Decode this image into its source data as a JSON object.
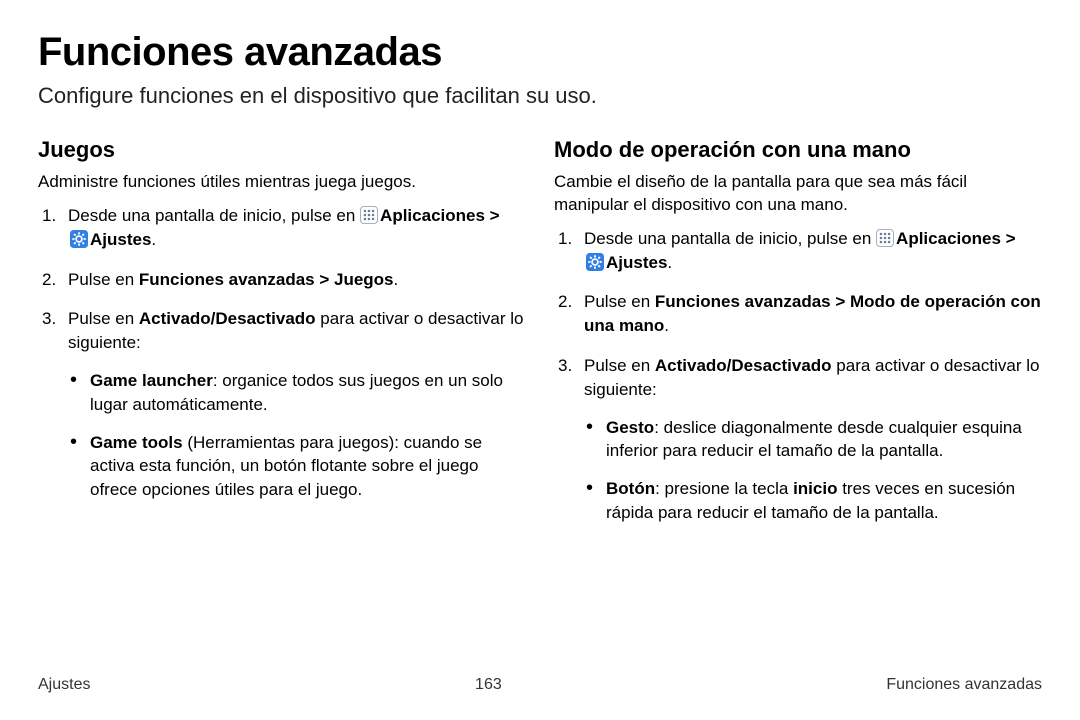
{
  "page": {
    "title": "Funciones avanzadas",
    "subtitle": "Configure funciones en el dispositivo que facilitan su uso."
  },
  "icons": {
    "apps_label": "Aplicaciones",
    "settings_label": "Ajustes"
  },
  "left": {
    "heading": "Juegos",
    "desc": "Administre funciones útiles mientras juega juegos.",
    "step1_a": "Desde una pantalla de inicio, pulse en ",
    "step1_apps": "Aplicaciones",
    "step1_sep": " > ",
    "step1_settings": "Ajustes",
    "step1_end": ".",
    "step2_a": "Pulse en ",
    "step2_b": "Funciones avanzadas > Juegos",
    "step2_c": ".",
    "step3_a": "Pulse en ",
    "step3_b": "Activado/Desactivado",
    "step3_c": " para activar o desactivar lo siguiente:",
    "bullet1_b": "Game launcher",
    "bullet1_t": ": organice todos sus juegos en un solo lugar automáticamente.",
    "bullet2_b": "Game tools",
    "bullet2_t": " (Herramientas para juegos): cuando se activa esta función, un botón flotante sobre el juego ofrece opciones útiles para el juego."
  },
  "right": {
    "heading": "Modo de operación con una mano",
    "desc": "Cambie el diseño de la pantalla para que sea más fácil manipular el dispositivo con una mano.",
    "step1_a": "Desde una pantalla de inicio, pulse en ",
    "step1_apps": "Aplicaciones",
    "step1_sep": " > ",
    "step1_settings": "Ajustes",
    "step1_end": ".",
    "step2_a": "Pulse en ",
    "step2_b": "Funciones avanzadas > Modo de operación con una mano",
    "step2_c": ".",
    "step3_a": "Pulse en ",
    "step3_b": "Activado/Desactivado",
    "step3_c": " para activar o desactivar lo siguiente:",
    "bullet1_b": "Gesto",
    "bullet1_t": ": deslice diagonalmente desde cualquier esquina inferior para reducir el tamaño de la pantalla.",
    "bullet2_b": "Botón",
    "bullet2_t1": ": presione la tecla ",
    "bullet2_t2": "inicio",
    "bullet2_t3": " tres veces en sucesión rápida para reducir el tamaño de la pantalla."
  },
  "footer": {
    "left": "Ajustes",
    "center": "163",
    "right": "Funciones avanzadas"
  }
}
